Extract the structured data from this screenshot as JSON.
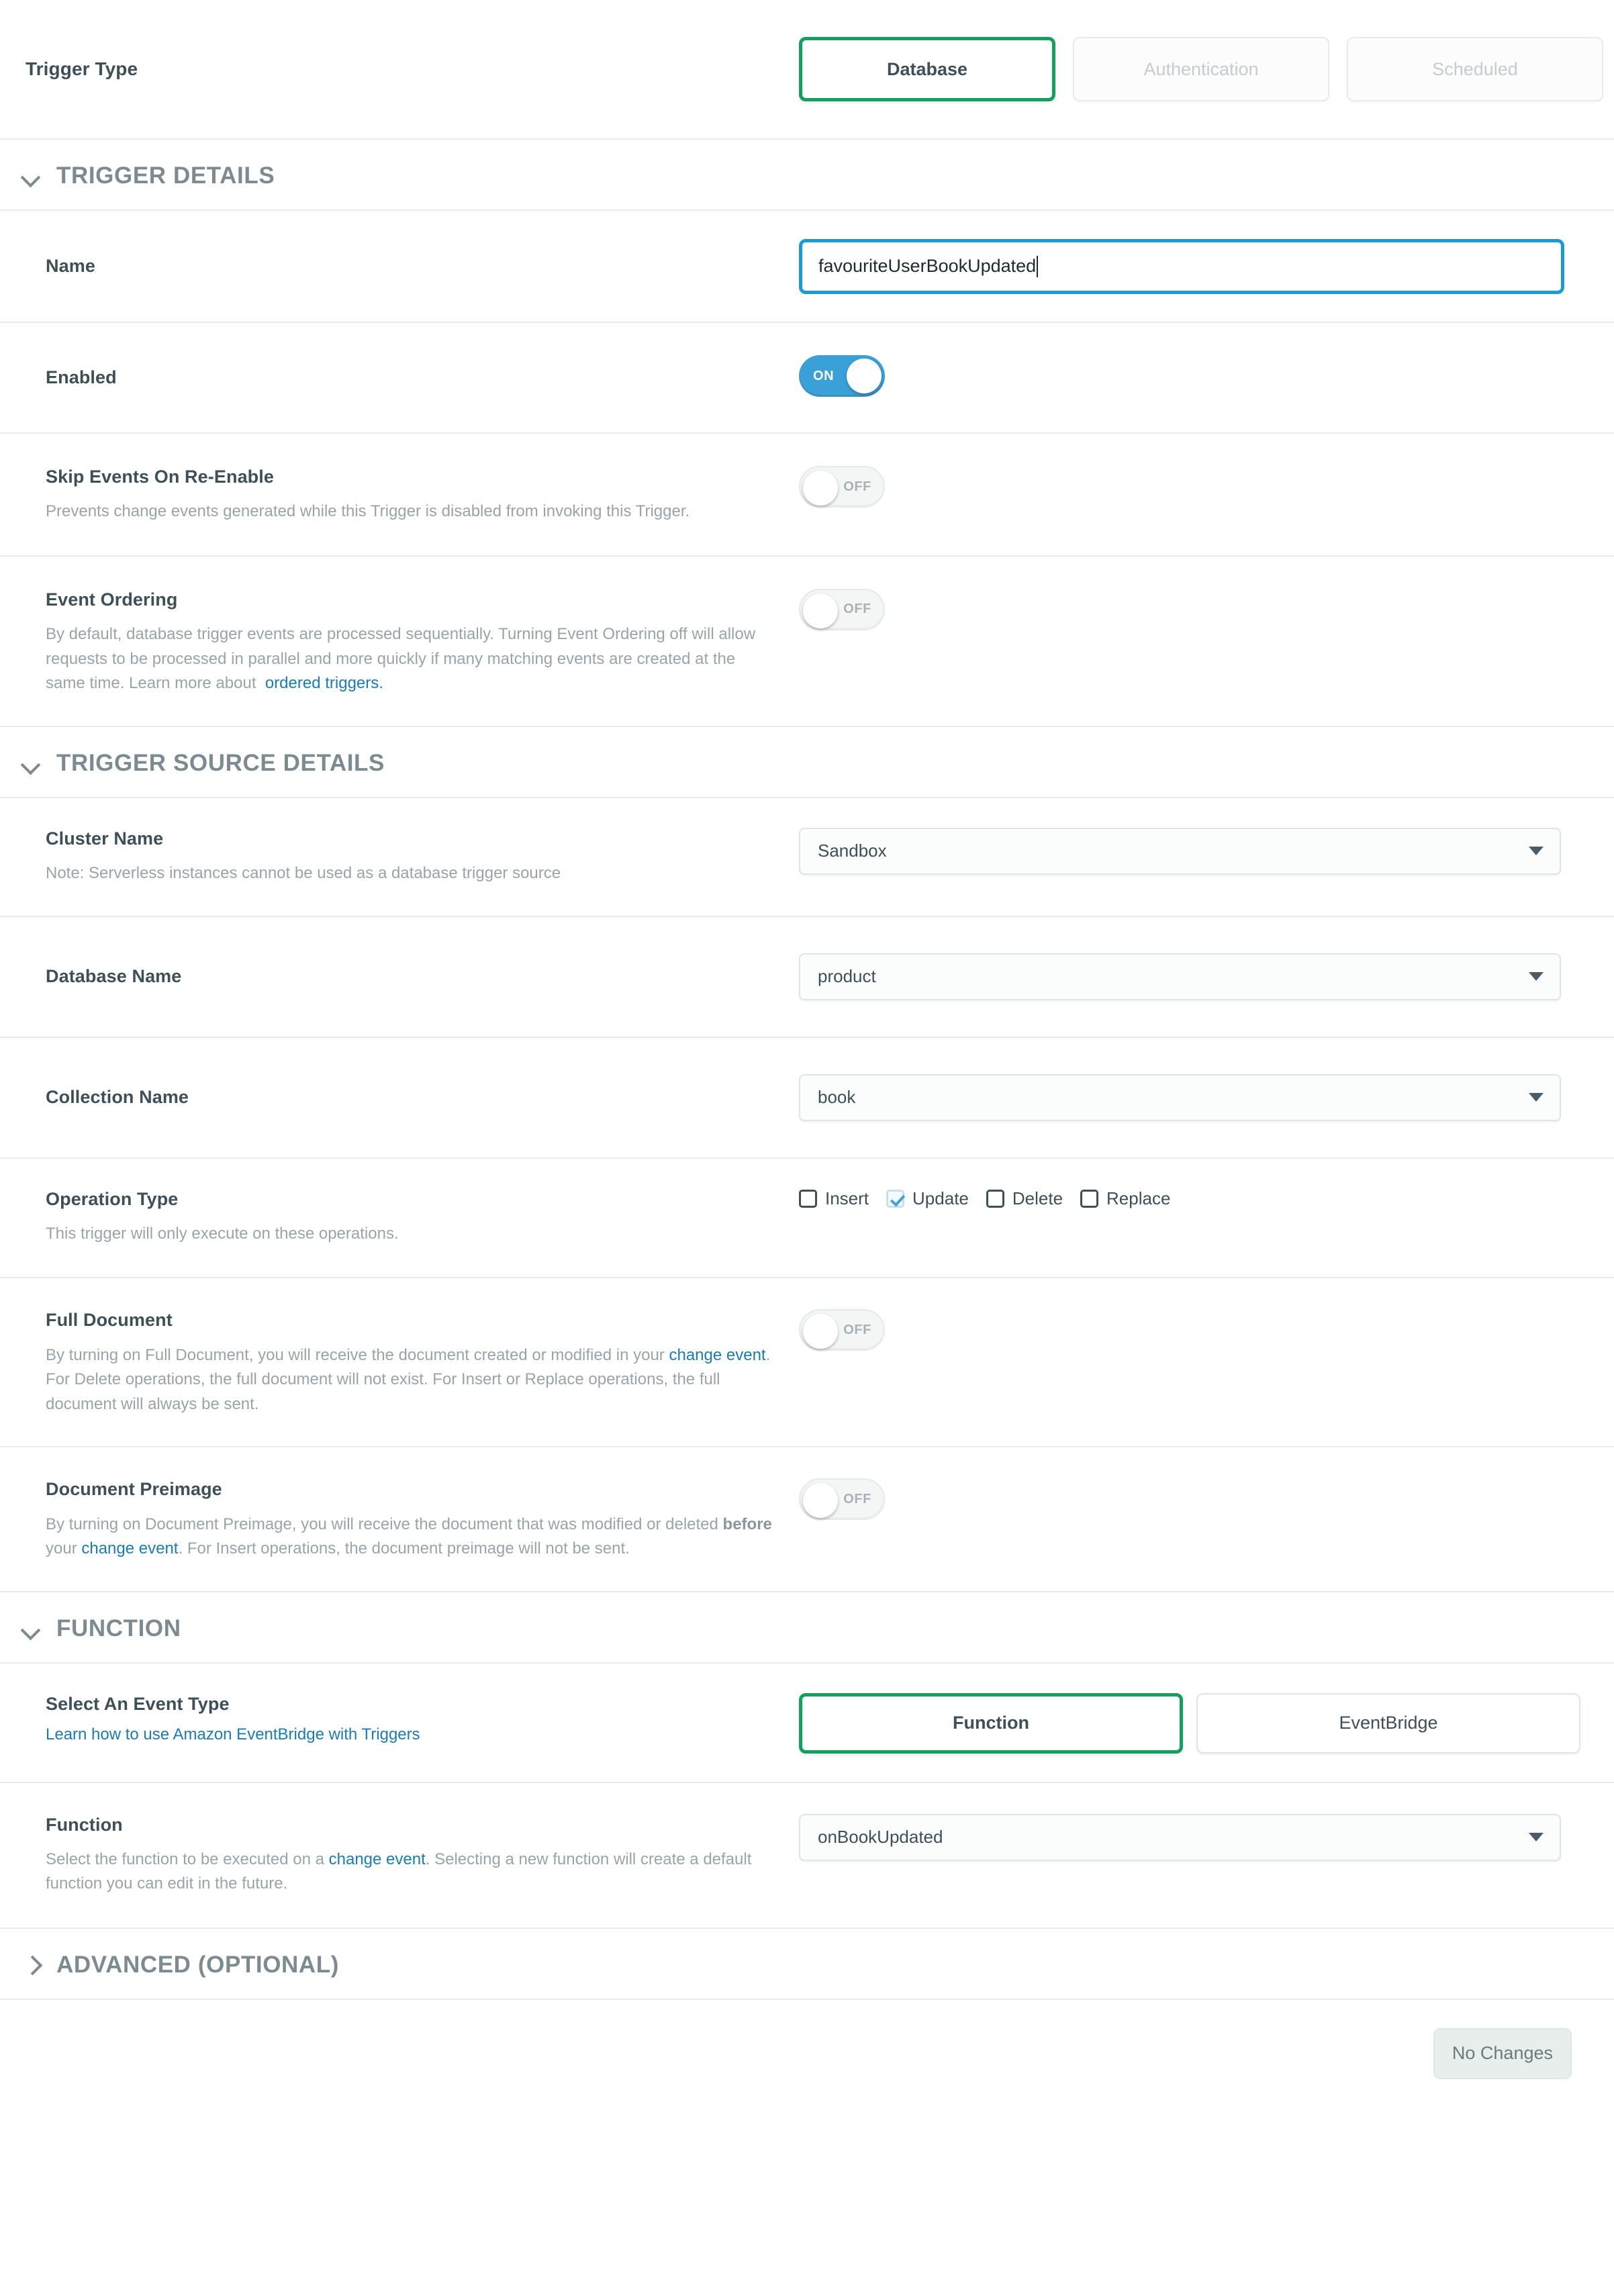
{
  "trigger_type": {
    "label": "Trigger Type",
    "options": [
      "Database",
      "Authentication",
      "Scheduled"
    ],
    "selected": "Database"
  },
  "sections": {
    "trigger_details": "TRIGGER DETAILS",
    "trigger_source_details": "TRIGGER SOURCE DETAILS",
    "function": "FUNCTION",
    "advanced": "ADVANCED (OPTIONAL)"
  },
  "name": {
    "label": "Name",
    "value": "favouriteUserBookUpdated"
  },
  "enabled": {
    "label": "Enabled",
    "state": "ON"
  },
  "skip_events": {
    "label": "Skip Events On Re-Enable",
    "desc": "Prevents change events generated while this Trigger is disabled from invoking this Trigger.",
    "state": "OFF"
  },
  "event_ordering": {
    "label": "Event Ordering",
    "desc_part1": "By default, database trigger events are processed sequentially. Turning Event Ordering off will allow requests to be processed in parallel and more quickly if many matching events are created at the same time. Learn more about",
    "link": "ordered triggers.",
    "state": "OFF"
  },
  "cluster_name": {
    "label": "Cluster Name",
    "desc": "Note: Serverless instances cannot be used as a database trigger source",
    "value": "Sandbox"
  },
  "database_name": {
    "label": "Database Name",
    "value": "product"
  },
  "collection_name": {
    "label": "Collection Name",
    "value": "book"
  },
  "operation_type": {
    "label": "Operation Type",
    "desc": "This trigger will only execute on these operations.",
    "options": [
      {
        "label": "Insert",
        "checked": false
      },
      {
        "label": "Update",
        "checked": true
      },
      {
        "label": "Delete",
        "checked": false
      },
      {
        "label": "Replace",
        "checked": false
      }
    ]
  },
  "full_document": {
    "label": "Full Document",
    "desc_part1": "By turning on Full Document, you will receive the document created or modified in your",
    "link": "change event",
    "desc_part2": ". For Delete operations, the full document will not exist. For Insert or Replace operations, the full document will always be sent.",
    "state": "OFF"
  },
  "document_preimage": {
    "label": "Document Preimage",
    "desc_part1": "By turning on Document Preimage, you will receive the document that was modified or deleted",
    "bold_word": "before",
    "desc_part2": "your",
    "link": "change event",
    "desc_part3": ". For Insert operations, the document preimage will not be sent.",
    "state": "OFF"
  },
  "select_event_type": {
    "label": "Select An Event Type",
    "link": "Learn how to use Amazon EventBridge with Triggers",
    "options": [
      "Function",
      "EventBridge"
    ],
    "selected": "Function"
  },
  "function": {
    "label": "Function",
    "desc_part1": "Select the function to be executed on a",
    "link": "change event",
    "desc_part2": ". Selecting a new function will create a default function you can edit in the future.",
    "value": "onBookUpdated"
  },
  "footer": {
    "save_label": "No Changes"
  },
  "colors": {
    "accent_green": "#13a05c",
    "toggle_on_blue": "#3aa0d8",
    "focus_blue": "#1c9ad6",
    "link_blue": "#1a7cb5",
    "label_dark": "#3d4f58",
    "muted_gray": "#9aa4a8"
  }
}
